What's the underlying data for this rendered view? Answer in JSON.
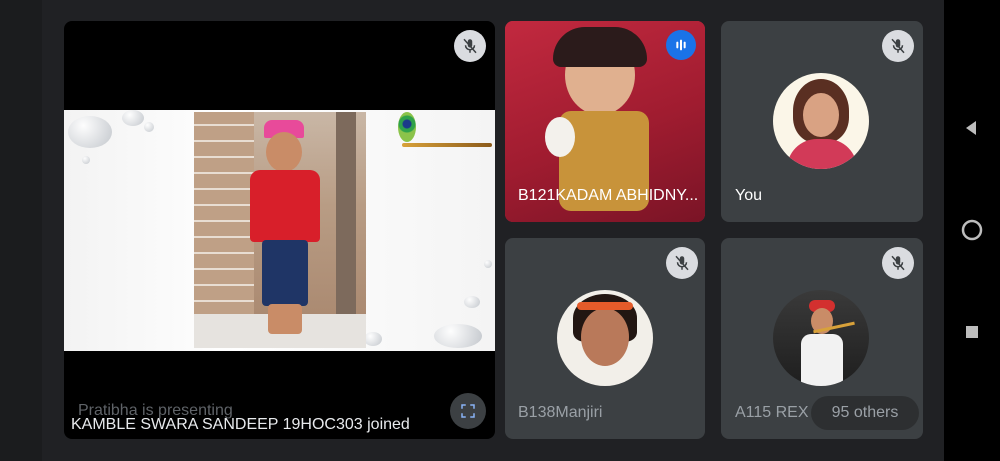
{
  "presentation": {
    "presenting_text": "Pratibha is presenting",
    "join_notification": "KAMBLE SWARA SANDEEP 19HOC303 joined",
    "mic_icon": "mic-off-icon",
    "fullscreen_icon": "fullscreen-icon"
  },
  "participants": [
    {
      "name": "B121KADAM ABHIDNY...",
      "status_icon": "audio-speaking-icon"
    },
    {
      "name": "You",
      "status_icon": "mic-off-icon"
    },
    {
      "name": "B138Manjiri",
      "status_icon": "mic-off-icon"
    },
    {
      "name": "A115 REX",
      "status_icon": "mic-off-icon"
    }
  ],
  "others_label": "95 others",
  "nav": {
    "back_icon": "back-triangle-icon",
    "home_icon": "home-circle-icon",
    "recent_icon": "recents-square-icon"
  },
  "colors": {
    "background": "#202124",
    "tile": "#3c4043",
    "speaking_accent": "#1a73e8"
  }
}
